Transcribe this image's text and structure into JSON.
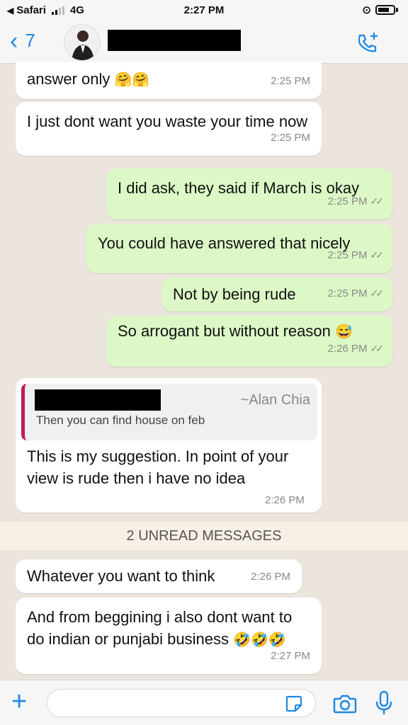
{
  "status_bar": {
    "back_app": "Safari",
    "network": "4G",
    "time": "2:27 PM"
  },
  "header": {
    "back_count": "7"
  },
  "messages": [
    {
      "text": "answer only",
      "emoji": "🤗🤗",
      "time": "2:25 PM"
    },
    {
      "text": "I just dont want you waste your time now",
      "time": "2:25 PM"
    },
    {
      "text": "I did ask, they said if March is okay",
      "time": "2:25 PM",
      "status": "read"
    },
    {
      "text": "You could have answered that nicely",
      "time": "2:25 PM",
      "status": "read"
    },
    {
      "text": "Not by being rude",
      "time": "2:25 PM",
      "status": "read"
    },
    {
      "text": "So arrogant but without reason",
      "emoji": "😅",
      "time": "2:26 PM",
      "status": "read"
    },
    {
      "quote_author": "~Alan Chia",
      "quote_text": "Then you can find house on feb",
      "text": "This is my suggestion. In point of your view is rude then i have no idea",
      "time": "2:26 PM"
    },
    {
      "text": "Whatever you want to think",
      "time": "2:26 PM"
    },
    {
      "text": "And from beggining i also dont want to do indian or punjabi business",
      "emoji": "🤣🤣🤣",
      "time": "2:27 PM"
    }
  ],
  "unread_banner": "2 UNREAD MESSAGES",
  "input": {
    "value": "",
    "placeholder": ""
  },
  "colors": {
    "accent": "#1e88e5",
    "outgoing_bubble": "#dcf8c6",
    "incoming_bubble": "#ffffff",
    "chat_background": "#ece5dd",
    "quote_bar": "#c2185b"
  },
  "icons": [
    "back-chevron-icon",
    "add-call-icon",
    "plus-icon",
    "sticker-icon",
    "camera-icon",
    "mic-icon",
    "read-ticks-icon"
  ]
}
